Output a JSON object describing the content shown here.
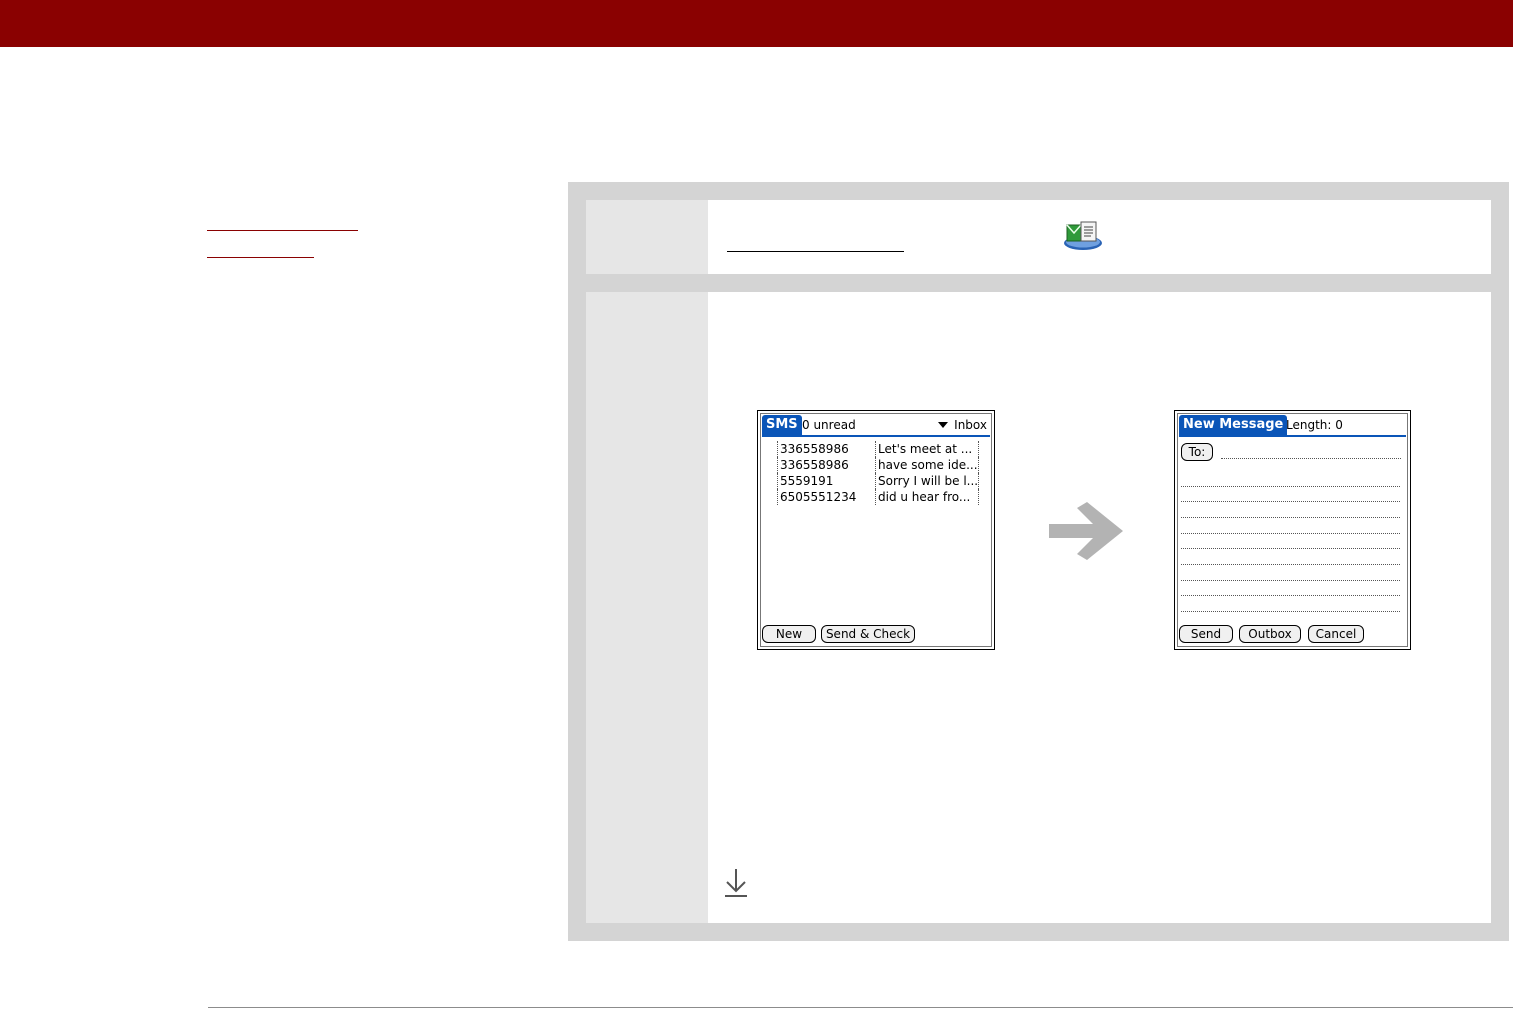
{
  "sms_screen": {
    "title": "SMS",
    "unread": "0 unread",
    "folder": "Inbox",
    "messages": [
      {
        "number": "336558986",
        "preview": "Let's meet at ..."
      },
      {
        "number": "336558986",
        "preview": "have some ide..."
      },
      {
        "number": "5559191",
        "preview": "Sorry I will be l..."
      },
      {
        "number": "6505551234",
        "preview": "did u hear fro..."
      }
    ],
    "buttons": {
      "new": "New",
      "send_check": "Send & Check"
    }
  },
  "new_message_screen": {
    "title": "New Message",
    "length": "Length: 0",
    "to_button": "To:",
    "buttons": {
      "send": "Send",
      "outbox": "Outbox",
      "cancel": "Cancel"
    }
  },
  "icons": {
    "app_icon": "sms-app-icon",
    "step_arrow": "right-arrow-icon",
    "continue": "download-arrow-icon"
  },
  "colors": {
    "brand": "#8a0101",
    "panel": "#d4d4d4",
    "palm_title": "#0a55b8"
  }
}
